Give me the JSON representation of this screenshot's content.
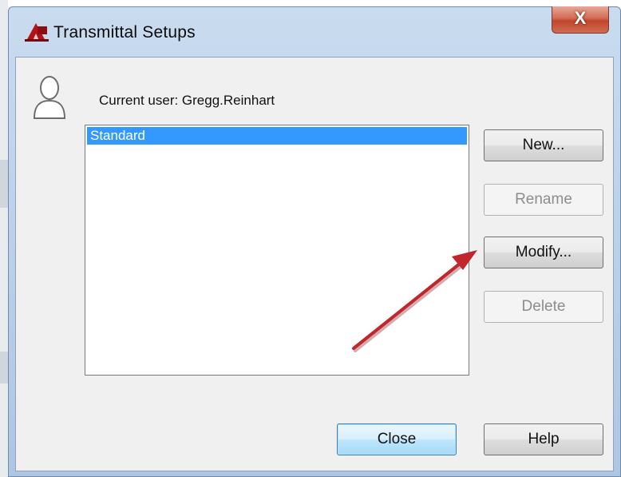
{
  "window": {
    "title": "Transmittal Setups",
    "close_glyph": "X"
  },
  "current_user_label": "Current user: Gregg.Reinhart",
  "setups_list": {
    "items": [
      {
        "label": "Standard",
        "selected": true
      }
    ]
  },
  "buttons": {
    "new": "New...",
    "rename": "Rename",
    "modify": "Modify...",
    "delete": "Delete",
    "close": "Close",
    "help": "Help"
  },
  "icons": {
    "app": "autocad-app-icon",
    "user": "user-silhouette-icon",
    "annotation": "red-arrow-annotation"
  },
  "colors": {
    "selection": "#3399ff",
    "annotation_arrow": "#c0262b",
    "titlebar": "#c9dbef"
  }
}
